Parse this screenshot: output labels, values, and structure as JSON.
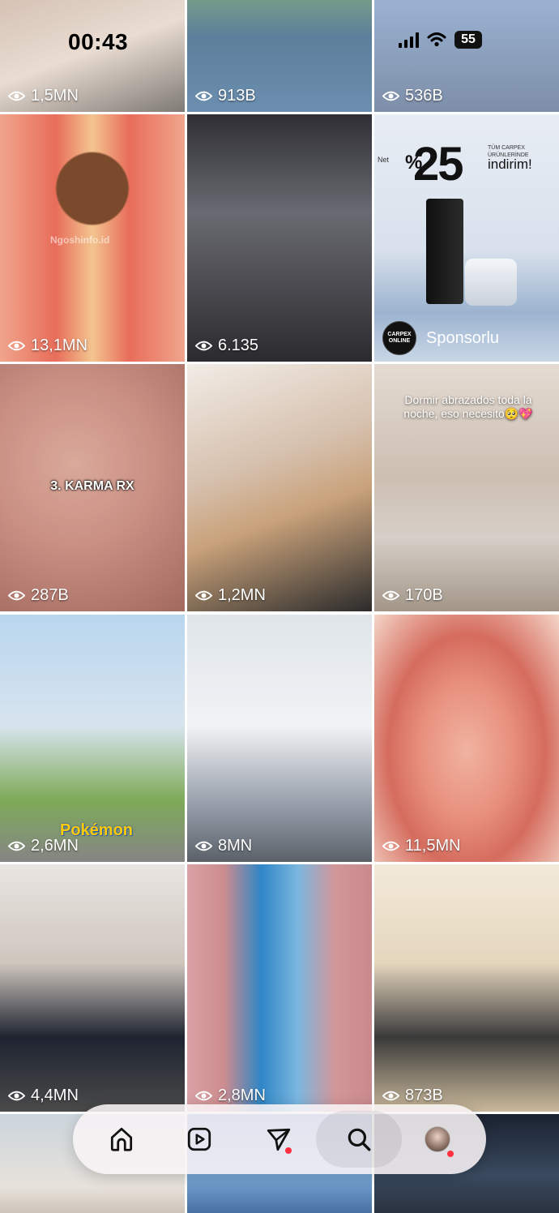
{
  "status_bar": {
    "time": "00:43",
    "battery": "55"
  },
  "grid": {
    "tiles": [
      {
        "views": "1,5MN"
      },
      {
        "views": "913B"
      },
      {
        "views": "536B"
      },
      {
        "views": "13,1MN",
        "watermark": "Ngoshinfo.id"
      },
      {
        "views": "6.135"
      },
      {
        "sponsored": true,
        "label": "Sponsorlu",
        "brand": "CARPEX ONLINE",
        "promo": {
          "prefix": "Net",
          "pct_sign": "%",
          "percent": "25",
          "small": "TÜM CARPEX ÜRÜNLERİNDE",
          "word": "indirim!"
        }
      },
      {
        "views": "287B",
        "overlay_text": "3. KARMA RX"
      },
      {
        "views": "1,2MN"
      },
      {
        "views": "170B",
        "caption": "Dormir abrazados toda la noche, eso necesito🥺💖"
      },
      {
        "views": "2,6MN",
        "overlay_text": "Pokémon"
      },
      {
        "views": "8MN"
      },
      {
        "views": "11,5MN"
      },
      {
        "views": "4,4MN"
      },
      {
        "views": "2,8MN"
      },
      {
        "views": "873B"
      }
    ]
  },
  "nav": {
    "items": [
      {
        "name": "home",
        "icon": "home-icon"
      },
      {
        "name": "reels",
        "icon": "reels-icon"
      },
      {
        "name": "messages",
        "icon": "send-icon"
      },
      {
        "name": "search",
        "icon": "search-icon",
        "active": true
      },
      {
        "name": "profile",
        "icon": "avatar"
      }
    ],
    "badge_color": "#ff3040"
  }
}
